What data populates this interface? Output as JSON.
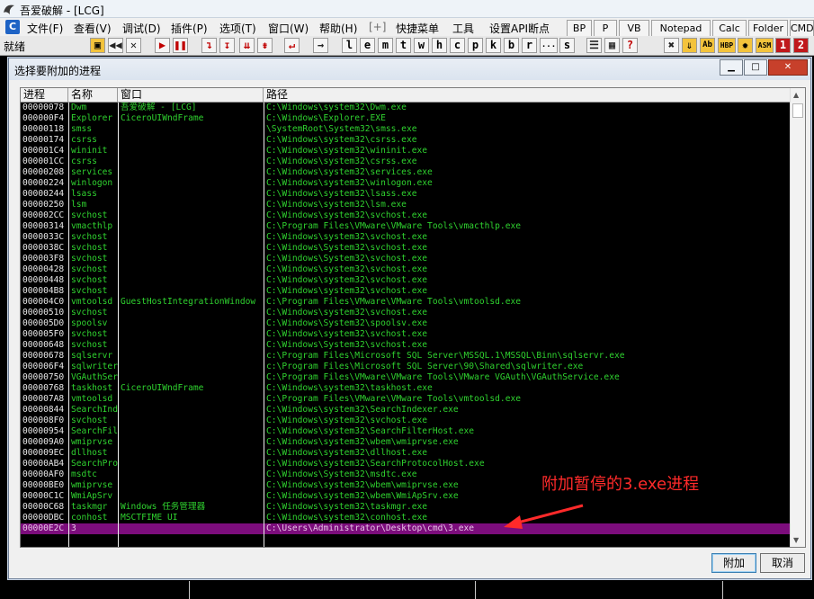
{
  "app": {
    "title": "吾爱破解 - [LCG]",
    "status": "就绪"
  },
  "menu": {
    "items": [
      "文件(F)",
      "查看(V)",
      "调试(D)",
      "插件(P)",
      "选项(T)",
      "窗口(W)",
      "帮助(H)",
      "[+]",
      "快捷菜单",
      "工具",
      "设置API断点"
    ],
    "right_buttons": [
      "BP",
      "P",
      "VB",
      "Notepad",
      "Calc",
      "Folder",
      "CMD"
    ]
  },
  "toolbar": {
    "letters": [
      "l",
      "e",
      "m",
      "t",
      "w",
      "h",
      "c",
      "p",
      "k",
      "b",
      "r",
      "...",
      "s"
    ]
  },
  "dialog": {
    "title": "选择要附加的进程",
    "columns": [
      "进程",
      "名称",
      "窗口",
      "路径"
    ],
    "rows": [
      [
        "00000078",
        "Dwm",
        "吾爱破解 - [LCG]",
        "C:\\Windows\\system32\\Dwm.exe"
      ],
      [
        "000000F4",
        "Explorer",
        "CiceroUIWndFrame",
        "C:\\Windows\\Explorer.EXE"
      ],
      [
        "00000118",
        "smss",
        "",
        "\\SystemRoot\\System32\\smss.exe"
      ],
      [
        "00000174",
        "csrss",
        "",
        "C:\\Windows\\system32\\csrss.exe"
      ],
      [
        "000001C4",
        "wininit",
        "",
        "C:\\Windows\\system32\\wininit.exe"
      ],
      [
        "000001CC",
        "csrss",
        "",
        "C:\\Windows\\system32\\csrss.exe"
      ],
      [
        "00000208",
        "services",
        "",
        "C:\\Windows\\system32\\services.exe"
      ],
      [
        "00000224",
        "winlogon",
        "",
        "C:\\Windows\\system32\\winlogon.exe"
      ],
      [
        "00000244",
        "lsass",
        "",
        "C:\\Windows\\system32\\lsass.exe"
      ],
      [
        "00000250",
        "lsm",
        "",
        "C:\\Windows\\system32\\lsm.exe"
      ],
      [
        "000002CC",
        "svchost",
        "",
        "C:\\Windows\\system32\\svchost.exe"
      ],
      [
        "00000314",
        "vmacthlp",
        "",
        "C:\\Program Files\\VMware\\VMware Tools\\vmacthlp.exe"
      ],
      [
        "0000033C",
        "svchost",
        "",
        "C:\\Windows\\system32\\svchost.exe"
      ],
      [
        "0000038C",
        "svchost",
        "",
        "C:\\Windows\\System32\\svchost.exe"
      ],
      [
        "000003F8",
        "svchost",
        "",
        "C:\\Windows\\System32\\svchost.exe"
      ],
      [
        "00000428",
        "svchost",
        "",
        "C:\\Windows\\system32\\svchost.exe"
      ],
      [
        "00000448",
        "svchost",
        "",
        "C:\\Windows\\system32\\svchost.exe"
      ],
      [
        "000004B8",
        "svchost",
        "",
        "C:\\Windows\\system32\\svchost.exe"
      ],
      [
        "000004C0",
        "vmtoolsd",
        "GuestHostIntegrationWindow",
        "C:\\Program Files\\VMware\\VMware Tools\\vmtoolsd.exe"
      ],
      [
        "00000510",
        "svchost",
        "",
        "C:\\Windows\\system32\\svchost.exe"
      ],
      [
        "000005D0",
        "spoolsv",
        "",
        "C:\\Windows\\System32\\spoolsv.exe"
      ],
      [
        "000005F0",
        "svchost",
        "",
        "C:\\Windows\\system32\\svchost.exe"
      ],
      [
        "00000648",
        "svchost",
        "",
        "C:\\Windows\\System32\\svchost.exe"
      ],
      [
        "00000678",
        "sqlservr",
        "",
        "c:\\Program Files\\Microsoft SQL Server\\MSSQL.1\\MSSQL\\Binn\\sqlservr.exe"
      ],
      [
        "000006F4",
        "sqlwriter",
        "",
        "c:\\Program Files\\Microsoft SQL Server\\90\\Shared\\sqlwriter.exe"
      ],
      [
        "00000750",
        "VGAuthService",
        "",
        "C:\\Program Files\\VMware\\VMware Tools\\VMware VGAuth\\VGAuthService.exe"
      ],
      [
        "00000768",
        "taskhost",
        "CiceroUIWndFrame",
        "C:\\Windows\\system32\\taskhost.exe"
      ],
      [
        "000007A8",
        "vmtoolsd",
        "",
        "C:\\Program Files\\VMware\\VMware Tools\\vmtoolsd.exe"
      ],
      [
        "00000844",
        "SearchIndexer",
        "",
        "C:\\Windows\\system32\\SearchIndexer.exe"
      ],
      [
        "000008F0",
        "svchost",
        "",
        "C:\\Windows\\system32\\svchost.exe"
      ],
      [
        "00000954",
        "SearchFilterHost",
        "",
        "C:\\Windows\\system32\\SearchFilterHost.exe"
      ],
      [
        "000009A0",
        "wmiprvse",
        "",
        "C:\\Windows\\system32\\wbem\\wmiprvse.exe"
      ],
      [
        "000009EC",
        "dllhost",
        "",
        "C:\\Windows\\system32\\dllhost.exe"
      ],
      [
        "00000AB4",
        "SearchProtocolHost",
        "",
        "C:\\Windows\\system32\\SearchProtocolHost.exe"
      ],
      [
        "00000AF0",
        "msdtc",
        "",
        "C:\\Windows\\System32\\msdtc.exe"
      ],
      [
        "00000BE0",
        "wmiprvse",
        "",
        "C:\\Windows\\system32\\wbem\\wmiprvse.exe"
      ],
      [
        "00000C1C",
        "WmiApSrv",
        "",
        "C:\\Windows\\system32\\wbem\\WmiApSrv.exe"
      ],
      [
        "00000C68",
        "taskmgr",
        "Windows 任务管理器",
        "C:\\Windows\\system32\\taskmgr.exe"
      ],
      [
        "00000DBC",
        "conhost",
        "MSCTFIME UI",
        "C:\\Windows\\system32\\conhost.exe"
      ],
      [
        "00000E2C",
        "3",
        "",
        "C:\\Users\\Administrator\\Desktop\\cmd\\3.exe"
      ]
    ],
    "selected_row": 39,
    "attach_label": "附加",
    "cancel_label": "取消"
  },
  "annotation": {
    "text": "附加暂停的3.exe进程",
    "color": "#ff2a2a"
  },
  "colors": {
    "list_background": "#000000",
    "text_green": "#2fd22f",
    "selection": "#7c0d7c"
  }
}
